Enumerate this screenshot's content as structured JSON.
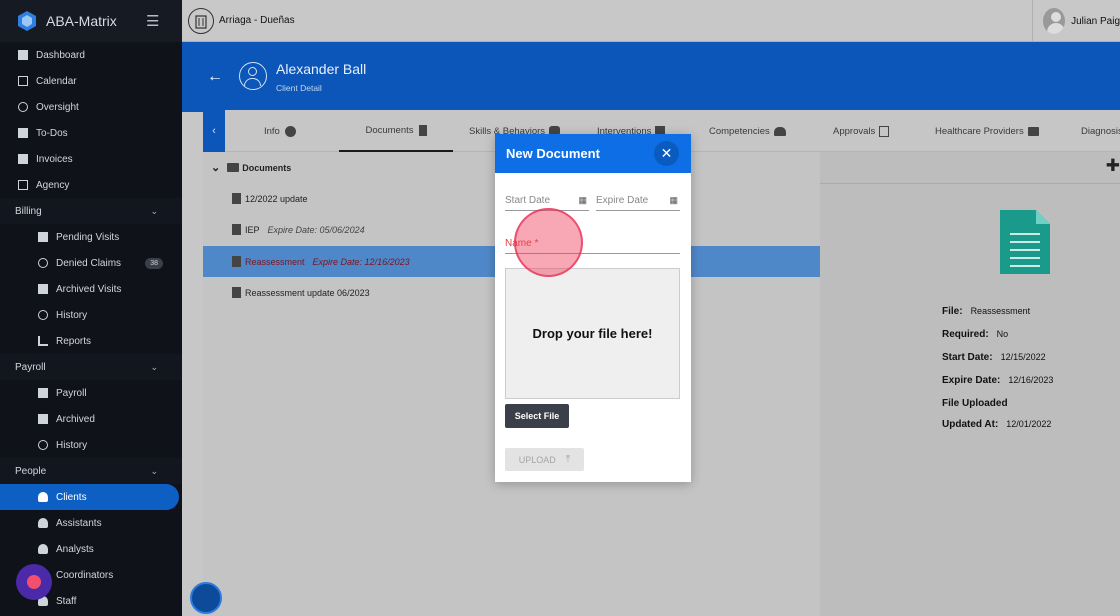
{
  "app": {
    "name": "ABA-Matrix"
  },
  "topbar": {
    "org_name": "Arriaga - Dueñas",
    "user_name": "Julian Paig"
  },
  "sidebar": {
    "items": [
      {
        "label": "Dashboard",
        "icon": "dashboard-icon"
      },
      {
        "label": "Calendar",
        "icon": "calendar-icon"
      },
      {
        "label": "Oversight",
        "icon": "eye-icon"
      },
      {
        "label": "To-Dos",
        "icon": "todo-icon"
      },
      {
        "label": "Invoices",
        "icon": "invoice-icon"
      },
      {
        "label": "Agency",
        "icon": "building-icon"
      }
    ],
    "billing": {
      "label": "Billing",
      "items": [
        {
          "label": "Pending Visits"
        },
        {
          "label": "Denied Claims",
          "badge": "38"
        },
        {
          "label": "Archived Visits"
        },
        {
          "label": "History"
        },
        {
          "label": "Reports"
        }
      ]
    },
    "payroll": {
      "label": "Payroll",
      "items": [
        {
          "label": "Payroll"
        },
        {
          "label": "Archived"
        },
        {
          "label": "History"
        }
      ]
    },
    "people": {
      "label": "People",
      "items": [
        {
          "label": "Clients"
        },
        {
          "label": "Assistants"
        },
        {
          "label": "Analysts"
        },
        {
          "label": "Coordinators"
        },
        {
          "label": "Staff"
        }
      ]
    }
  },
  "header": {
    "client_name": "Alexander Ball",
    "subtitle": "Client Detail"
  },
  "tabs": [
    {
      "label": "Info"
    },
    {
      "label": "Documents"
    },
    {
      "label": "Skills & Behaviors"
    },
    {
      "label": "Interventions"
    },
    {
      "label": "Competencies"
    },
    {
      "label": "Approvals"
    },
    {
      "label": "Healthcare Providers"
    },
    {
      "label": "Diagnosis"
    }
  ],
  "tree": {
    "root": "Documents",
    "rows": [
      {
        "name": "12/2022 update",
        "expire": ""
      },
      {
        "name": "IEP",
        "expire": "Expire Date: 05/06/2024"
      },
      {
        "name": "Reassessment",
        "expire": "Expire Date: 12/16/2023"
      },
      {
        "name": "Reassessment update 06/2023",
        "expire": ""
      }
    ]
  },
  "detail": {
    "file_label": "File:",
    "file_value": "Reassessment",
    "required_label": "Required:",
    "required_value": "No",
    "start_label": "Start Date:",
    "start_value": "12/15/2022",
    "expire_label": "Expire Date:",
    "expire_value": "12/16/2023",
    "uploaded_label": "File Uploaded",
    "updated_label": "Updated At:",
    "updated_value": "12/01/2022"
  },
  "modal": {
    "title": "New Document",
    "start_placeholder": "Start Date",
    "expire_placeholder": "Expire Date",
    "name_placeholder": "Name *",
    "dropzone_text": "Drop your file here!",
    "select_label": "Select File",
    "upload_label": "UPLOAD"
  },
  "colors": {
    "accent": "#0b56b8",
    "modal_header": "#0d6ee6",
    "sidebar": "#0f1219",
    "doc_icon": "#1a9a8a"
  }
}
